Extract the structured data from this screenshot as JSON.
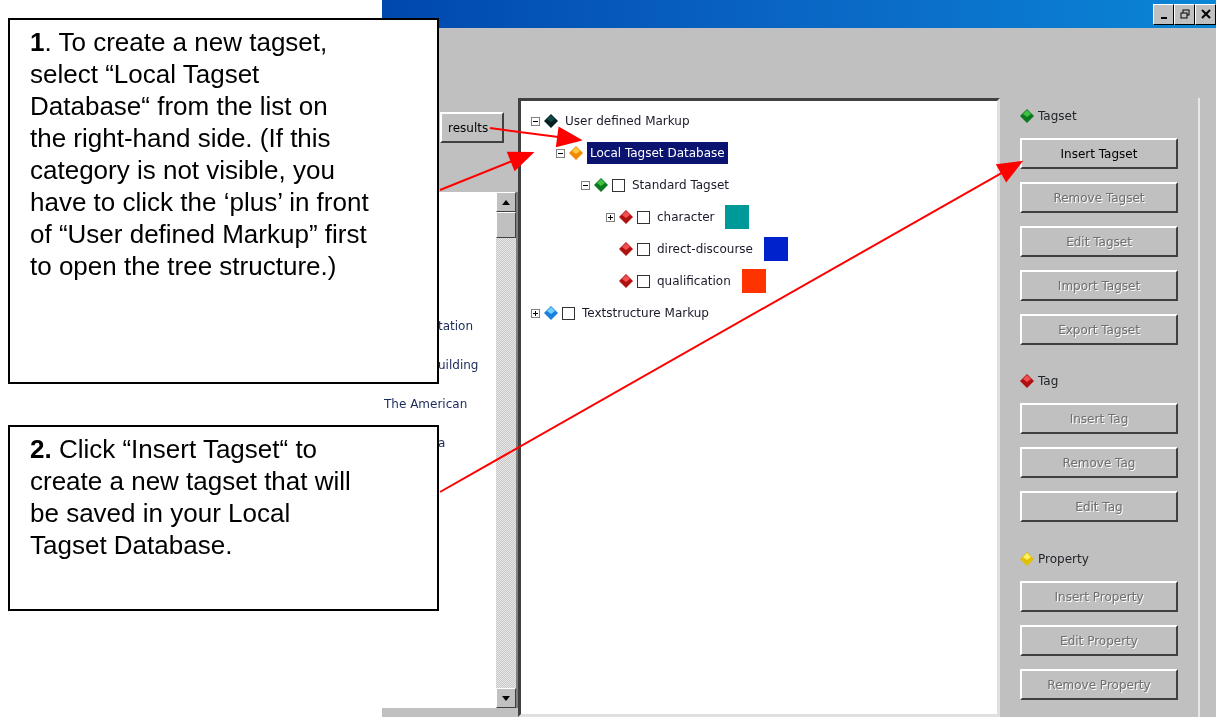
{
  "left_panel": {
    "button": "results",
    "list_items": [
      {
        "text": "tation",
        "kind": "partial"
      },
      {
        "text": "uilding",
        "kind": "partial"
      },
      {
        "text": "The American",
        "kind": "full"
      },
      {
        "text": "a",
        "kind": "partial"
      }
    ]
  },
  "tree": [
    {
      "label": "User defined Markup",
      "kind": "markup",
      "expanded": true,
      "selected": false,
      "children": [
        {
          "label": "Local Tagset Database",
          "kind": "database",
          "expanded": true,
          "selected": true,
          "children": [
            {
              "label": "Standard Tagset",
              "kind": "tagset",
              "expanded": true,
              "checked": false,
              "selected": false,
              "children": [
                {
                  "label": "character",
                  "kind": "tag",
                  "expanded": false,
                  "checked": false,
                  "selected": false,
                  "color": "#009999"
                },
                {
                  "label": "direct-discourse",
                  "kind": "tag",
                  "checked": false,
                  "selected": false,
                  "color": "#0022cc"
                },
                {
                  "label": "qualification",
                  "kind": "tag",
                  "checked": false,
                  "selected": false,
                  "color": "#ff3300"
                }
              ]
            }
          ]
        }
      ]
    },
    {
      "label": "Textstructure Markup",
      "kind": "structure",
      "expanded": false,
      "checked": false,
      "selected": false
    }
  ],
  "sections": [
    {
      "title": "Tagset",
      "kind": "tagset",
      "buttons": [
        {
          "label": "Insert Tagset",
          "disabled": false
        },
        {
          "label": "Remove Tagset",
          "disabled": true
        },
        {
          "label": "Edit Tagset",
          "disabled": true
        },
        {
          "label": "Import Tagset",
          "disabled": true
        },
        {
          "label": "Export Tagset",
          "disabled": true
        }
      ]
    },
    {
      "title": "Tag",
      "kind": "tag",
      "buttons": [
        {
          "label": "Insert Tag",
          "disabled": true
        },
        {
          "label": "Remove Tag",
          "disabled": true
        },
        {
          "label": "Edit Tag",
          "disabled": true
        }
      ]
    },
    {
      "title": "Property",
      "kind": "property",
      "buttons": [
        {
          "label": "Insert Property",
          "disabled": true
        },
        {
          "label": "Edit Property",
          "disabled": true
        },
        {
          "label": "Remove Property",
          "disabled": true
        }
      ]
    }
  ],
  "callouts": [
    {
      "text": "**1**. To create a new tagset, select “Local Tagset Database“ from the list on the right-hand side. (If this category is not visible, you have to click the ‘plus’ in front of “User defined Markup” first to open the tree structure.)"
    },
    {
      "text": "**2.** Click “Insert Tagset“ to create a new tagset that will be saved in your Local Tagset Database."
    }
  ]
}
